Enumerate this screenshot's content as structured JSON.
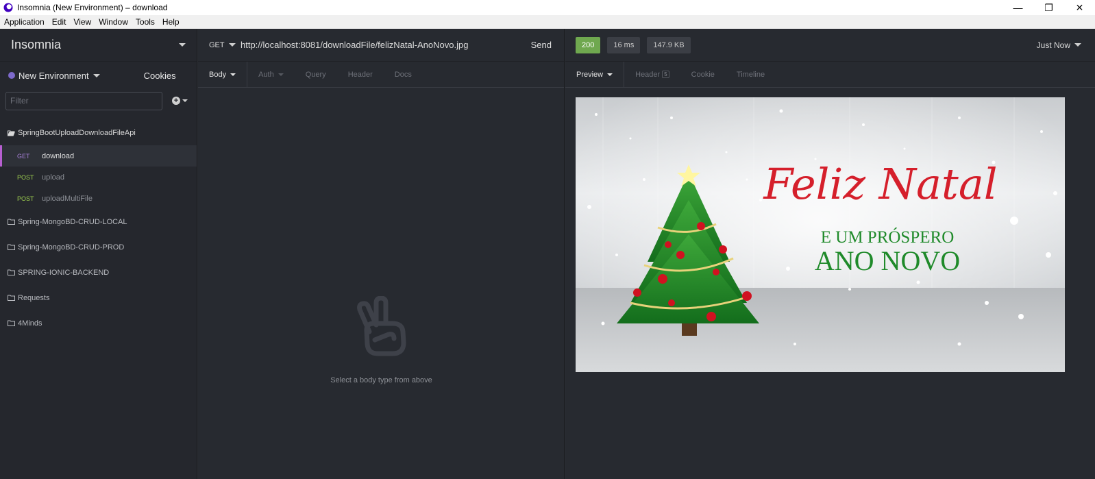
{
  "window": {
    "title": "Insomnia (New Environment) – download",
    "controls": [
      "—",
      "❐",
      "✕"
    ]
  },
  "menu": [
    {
      "label": "Application"
    },
    {
      "label": "Edit"
    },
    {
      "label": "View"
    },
    {
      "label": "Window"
    },
    {
      "label": "Tools"
    },
    {
      "label": "Help"
    }
  ],
  "sidebar": {
    "workspace": "Insomnia",
    "environment": "New Environment",
    "cookies": "Cookies",
    "filter_placeholder": "Filter",
    "open_folder": "SpringBootUploadDownloadFileApi",
    "requests": [
      {
        "method": "GET",
        "name": "download",
        "active": true
      },
      {
        "method": "POST",
        "name": "upload",
        "active": false
      },
      {
        "method": "POST",
        "name": "uploadMultiFile",
        "active": false
      }
    ],
    "folders": [
      "Spring-MongoBD-CRUD-LOCAL",
      "Spring-MongoBD-CRUD-PROD",
      "SPRING-IONIC-BACKEND",
      "Requests",
      "4Minds"
    ]
  },
  "request": {
    "method": "GET",
    "url": "http://localhost:8081/downloadFile/felizNatal-AnoNovo.jpg",
    "send": "Send",
    "tabs": [
      "Body",
      "Auth",
      "Query",
      "Header",
      "Docs"
    ],
    "empty_hint": "Select a body type from above"
  },
  "response": {
    "status": "200",
    "time": "16 ms",
    "size": "147.9 KB",
    "history": "Just Now",
    "tabs": [
      "Preview",
      "Header",
      "Cookie",
      "Timeline"
    ],
    "header_count": "5",
    "image": {
      "line1": "Feliz Natal",
      "line2": "E UM PRÓSPERO",
      "line3": "ANO NOVO"
    }
  },
  "colors": {
    "accent_purple": "#7d69cb",
    "get_method": "#a67fd6",
    "post_method": "#9ccc4f",
    "status_ok": "#6fa84f"
  }
}
